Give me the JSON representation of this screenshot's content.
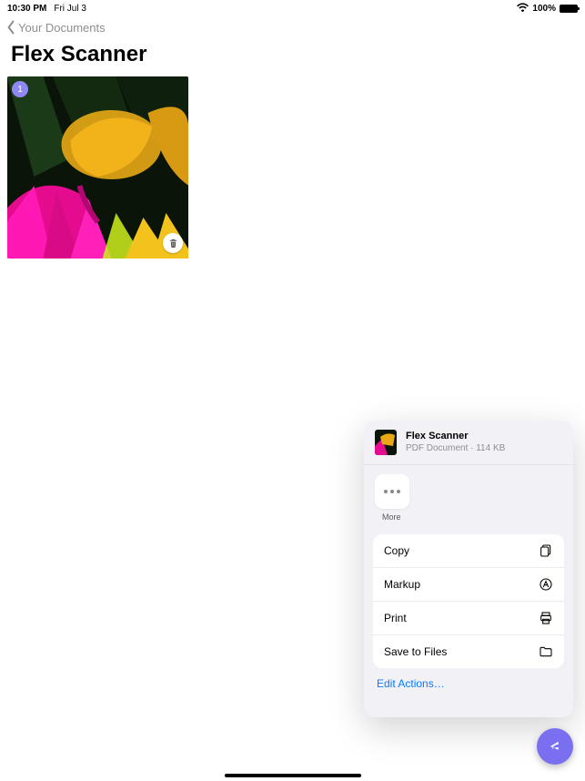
{
  "status": {
    "time": "10:30 PM",
    "date": "Fri Jul 3",
    "battery_percent": "100%"
  },
  "nav": {
    "back_label": "Your Documents"
  },
  "page": {
    "title": "Flex Scanner"
  },
  "thumbnail": {
    "badge": "1"
  },
  "share_sheet": {
    "doc_title": "Flex Scanner",
    "doc_subtitle": "PDF Document · 114 KB",
    "more_label": "More",
    "actions": {
      "copy": "Copy",
      "markup": "Markup",
      "print": "Print",
      "save_to_files": "Save to Files"
    },
    "edit_actions": "Edit Actions…"
  }
}
